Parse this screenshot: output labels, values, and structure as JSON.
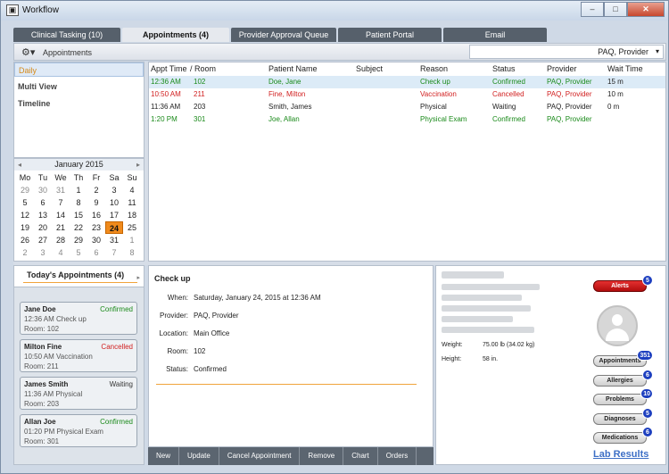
{
  "window": {
    "title": "Workflow",
    "app_icon": "app-icon",
    "controls": [
      "–",
      "□",
      "✕"
    ]
  },
  "tabs": [
    {
      "label": "Clinical Tasking  (10)",
      "active": false
    },
    {
      "label": "Appointments  (4)",
      "active": true
    },
    {
      "label": "Provider Approval Queue",
      "active": false
    },
    {
      "label": "Patient Portal",
      "active": false
    },
    {
      "label": "Email",
      "active": false
    }
  ],
  "subbar": {
    "label": "Appointments",
    "provider_select": "PAQ, Provider"
  },
  "leftnav": [
    "Daily",
    "Multi View",
    "Timeline"
  ],
  "calendar": {
    "title": "January 2015",
    "prev": "◂",
    "next": "▸",
    "dow": [
      "Mo",
      "Tu",
      "We",
      "Th",
      "Fr",
      "Sa",
      "Su"
    ],
    "weeks": [
      [
        "29",
        "30",
        "31",
        "1",
        "2",
        "3",
        "4"
      ],
      [
        "5",
        "6",
        "7",
        "8",
        "9",
        "10",
        "11"
      ],
      [
        "12",
        "13",
        "14",
        "15",
        "16",
        "17",
        "18"
      ],
      [
        "19",
        "20",
        "21",
        "22",
        "23",
        "24",
        "25"
      ],
      [
        "26",
        "27",
        "28",
        "29",
        "30",
        "31",
        "1"
      ],
      [
        "2",
        "3",
        "4",
        "5",
        "6",
        "7",
        "8"
      ]
    ],
    "selected": "24"
  },
  "grid": {
    "headers": [
      "Appt Time",
      "/ Room",
      "Patient Name",
      "Subject",
      "Reason",
      "Status",
      "Provider",
      "Wait Time"
    ],
    "rows": [
      {
        "time": "12:36 AM",
        "room": "102",
        "name": "Doe, Jane",
        "subject": "",
        "reason": "Check up",
        "status": "Confirmed",
        "provider": "PAQ, Provider",
        "wait": "15 m",
        "color": "#1a8a1a",
        "selected": true
      },
      {
        "time": "10:50 AM",
        "room": "211",
        "name": "Fine, Milton",
        "subject": "",
        "reason": "Vaccination",
        "status": "Cancelled",
        "provider": "PAQ, Provider",
        "wait": "10 m",
        "color": "#d11f1f",
        "selected": false
      },
      {
        "time": "11:36 AM",
        "room": "203",
        "name": "Smith, James",
        "subject": "",
        "reason": "Physical",
        "status": "Waiting",
        "provider": "PAQ, Provider",
        "wait": "0 m",
        "color": "#222222",
        "selected": false
      },
      {
        "time": "1:20 PM",
        "room": "301",
        "name": "Joe, Allan",
        "subject": "",
        "reason": "Physical Exam",
        "status": "Confirmed",
        "provider": "PAQ, Provider",
        "wait": "",
        "color": "#1a8a1a",
        "selected": false
      }
    ]
  },
  "today_panel": {
    "title": "Today's Appointments (4)",
    "cards": [
      {
        "name": "Jane Doe",
        "status": "Confirmed",
        "status_color": "#1a8a1a",
        "desc": "12:36 AM Check up",
        "room": "Room:  102"
      },
      {
        "name": "Milton Fine",
        "status": "Cancelled",
        "status_color": "#d11f1f",
        "desc": "10:50 AM Vaccination",
        "room": "Room:  211"
      },
      {
        "name": "James Smith",
        "status": "Waiting",
        "status_color": "#333333",
        "desc": "11:36 AM Physical",
        "room": "Room:  203"
      },
      {
        "name": "Allan Joe",
        "status": "Confirmed",
        "status_color": "#1a8a1a",
        "desc": "01:20 PM Physical Exam",
        "room": "Room:  301"
      }
    ]
  },
  "detail": {
    "title": "Check up",
    "fields": [
      {
        "k": "When:",
        "v": "Saturday, January 24, 2015 at 12:36 AM"
      },
      {
        "k": "Provider:",
        "v": "PAQ, Provider"
      },
      {
        "k": "Location:",
        "v": "Main Office"
      },
      {
        "k": "Room:",
        "v": "102"
      },
      {
        "k": "Status:",
        "v": "Confirmed"
      }
    ]
  },
  "actions": [
    "New",
    "Update",
    "Cancel Appointment",
    "Remove",
    "Chart",
    "Orders"
  ],
  "patient": {
    "weight_label": "Weight:",
    "weight": "75.00 lb (34.02 kg)",
    "height_label": "Height:",
    "height": "58 in.",
    "buttons": [
      {
        "label": "Alerts",
        "badge": "5"
      },
      {
        "label": "Appointments",
        "badge": "351"
      },
      {
        "label": "Allergies",
        "badge": "6"
      },
      {
        "label": "Problems",
        "badge": "10"
      },
      {
        "label": "Diagnoses",
        "badge": "5"
      },
      {
        "label": "Medications",
        "badge": "6"
      }
    ],
    "lab_results": "Lab Results"
  }
}
